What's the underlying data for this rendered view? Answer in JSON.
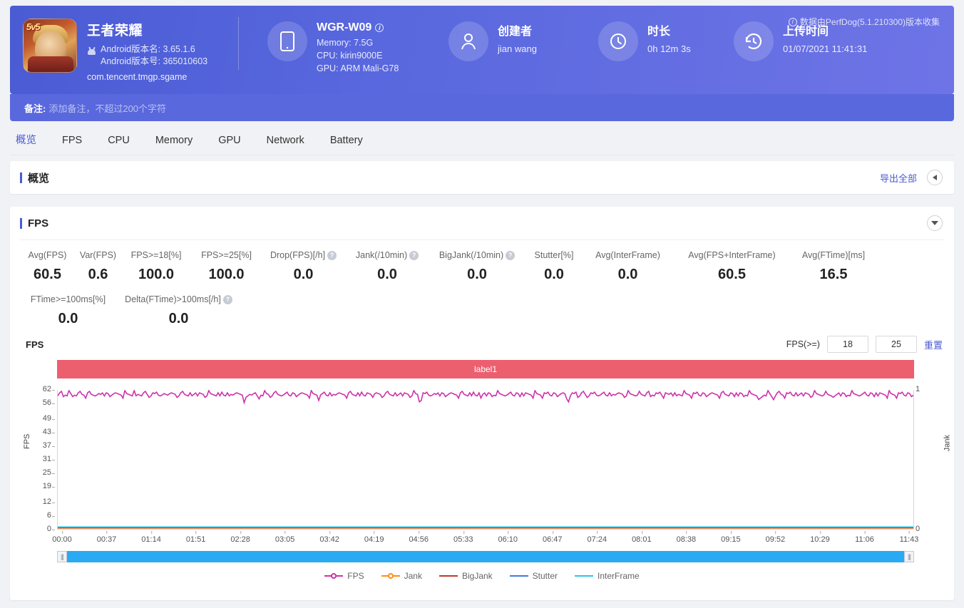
{
  "header": {
    "game": {
      "icon_badge": "5v5",
      "title": "王者荣耀",
      "android_version_name": "Android版本名: 3.65.1.6",
      "android_version_code": "Android版本号: 365010603",
      "package": "com.tencent.tmgp.sgame"
    },
    "device": {
      "icon": "phone-icon",
      "name": "WGR-W09",
      "memory": "Memory: 7.5G",
      "cpu": "CPU: kirin9000E",
      "gpu": "GPU: ARM Mali-G78"
    },
    "creator": {
      "icon": "user-icon",
      "title": "创建者",
      "value": "jian wang"
    },
    "duration": {
      "icon": "clock-icon",
      "title": "时长",
      "value": "0h 12m 3s"
    },
    "upload": {
      "icon": "history-icon",
      "title": "上传时间",
      "value": "01/07/2021 11:41:31"
    },
    "perfdog_note": "数据由PerfDog(5.1.210300)版本收集",
    "note": {
      "label": "备注:",
      "placeholder": "添加备注，不超过200个字符"
    },
    "accent": "#4a5bd4"
  },
  "tabs": [
    {
      "label": "概览",
      "active": true
    },
    {
      "label": "FPS",
      "active": false
    },
    {
      "label": "CPU",
      "active": false
    },
    {
      "label": "Memory",
      "active": false
    },
    {
      "label": "GPU",
      "active": false
    },
    {
      "label": "Network",
      "active": false
    },
    {
      "label": "Battery",
      "active": false
    }
  ],
  "overview_section": {
    "title": "概览",
    "export_all": "导出全部",
    "collapse_icon": "chevron-left-circle-icon"
  },
  "fps_section": {
    "title": "FPS",
    "collapse_icon": "chevron-down-circle-icon",
    "metrics_row1": [
      {
        "label": "Avg(FPS)",
        "value": "60.5",
        "help": false
      },
      {
        "label": "Var(FPS)",
        "value": "0.6",
        "help": false
      },
      {
        "label": "FPS>=18[%]",
        "value": "100.0",
        "help": false
      },
      {
        "label": "FPS>=25[%]",
        "value": "100.0",
        "help": false
      },
      {
        "label": "Drop(FPS)[/h]",
        "value": "0.0",
        "help": true
      },
      {
        "label": "Jank(/10min)",
        "value": "0.0",
        "help": true
      },
      {
        "label": "BigJank(/10min)",
        "value": "0.0",
        "help": true
      },
      {
        "label": "Stutter[%]",
        "value": "0.0",
        "help": false
      },
      {
        "label": "Avg(InterFrame)",
        "value": "0.0",
        "help": false
      },
      {
        "label": "Avg(FPS+InterFrame)",
        "value": "60.5",
        "help": false
      },
      {
        "label": "Avg(FTime)[ms]",
        "value": "16.5",
        "help": false
      }
    ],
    "metrics_row2": [
      {
        "label": "FTime>=100ms[%]",
        "value": "0.0",
        "help": false
      },
      {
        "label": "Delta(FTime)>100ms[/h]",
        "value": "0.0",
        "help": true
      }
    ],
    "chart_title": "FPS",
    "threshold_label": "FPS(>=)",
    "threshold_low": "18",
    "threshold_high": "25",
    "reset_label": "重置",
    "label_bar_text": "label1"
  },
  "chart_data": {
    "type": "line",
    "title": "FPS",
    "xlabel": "",
    "ylabel": "FPS",
    "y2label": "Jank",
    "ylim": [
      0,
      62
    ],
    "y2lim": [
      0,
      1
    ],
    "yticks": [
      0,
      6,
      12,
      19,
      25,
      31,
      37,
      43,
      49,
      56,
      62
    ],
    "y2ticks": [
      0,
      1
    ],
    "xticks": [
      "00:00",
      "00:37",
      "01:14",
      "01:51",
      "02:28",
      "03:05",
      "03:42",
      "04:19",
      "04:56",
      "05:33",
      "06:10",
      "06:47",
      "07:24",
      "08:01",
      "08:38",
      "09:15",
      "09:52",
      "10:29",
      "11:06",
      "11:43"
    ],
    "grid": false,
    "legend_position": "bottom",
    "series": [
      {
        "name": "FPS",
        "color": "#cc33aa",
        "axis": "left",
        "avg": 60.5,
        "values": [
          60,
          60,
          61,
          59,
          60,
          60,
          61,
          60,
          59,
          60,
          60,
          60,
          61,
          60,
          60,
          59,
          60,
          61,
          60,
          60,
          60,
          59,
          60,
          60,
          61,
          60,
          60,
          60,
          59,
          60,
          61,
          60,
          60,
          60,
          60,
          59,
          61,
          60,
          60,
          60,
          60,
          61,
          59,
          60,
          60,
          60,
          60,
          61,
          60,
          59,
          60,
          60,
          60,
          61,
          60,
          60,
          59,
          60,
          60,
          60,
          61,
          60,
          60,
          60,
          59,
          60,
          60,
          61,
          60,
          60,
          60,
          60,
          59,
          60,
          61,
          60,
          60,
          60,
          60,
          59,
          60,
          61,
          60,
          60,
          60,
          60,
          60,
          59,
          61,
          60,
          60,
          60,
          59,
          60,
          60,
          61,
          60,
          60,
          60,
          60,
          57,
          58,
          59,
          60,
          60,
          61,
          60,
          59,
          58,
          60,
          60,
          61,
          60,
          60,
          59,
          60,
          60,
          61,
          60,
          60,
          60,
          59,
          60,
          61,
          60,
          60,
          60,
          60,
          59,
          60,
          61,
          60,
          60,
          60,
          60,
          59,
          61,
          60,
          60,
          60,
          58,
          59,
          60,
          61,
          60,
          60,
          60,
          59,
          60,
          60,
          61,
          60,
          60,
          60,
          60,
          59,
          60,
          61,
          60,
          60,
          60,
          60,
          59,
          61,
          60,
          60,
          60,
          60,
          60,
          59,
          61,
          60,
          60,
          60,
          59,
          60,
          60,
          61,
          60,
          60,
          60,
          60,
          59,
          60,
          61,
          60,
          60,
          60,
          60,
          59,
          60,
          61,
          60,
          60,
          57,
          58,
          60,
          60,
          61,
          60,
          60,
          59,
          60,
          60,
          61,
          60,
          60,
          60,
          59,
          60,
          61,
          60,
          60,
          60,
          60,
          59,
          60,
          61,
          60,
          60,
          60,
          60,
          59,
          61,
          60,
          60,
          60,
          58,
          60,
          61,
          60,
          60,
          60,
          59,
          60,
          60,
          61,
          60,
          60,
          60,
          60,
          59,
          60,
          61,
          60,
          60,
          60,
          60,
          59,
          61,
          60,
          60,
          60,
          60,
          60,
          59,
          61,
          60,
          60,
          60,
          59,
          60,
          60,
          61,
          60,
          60,
          60,
          60,
          59,
          60,
          61,
          60,
          60,
          58,
          57,
          60
        ]
      },
      {
        "name": "Jank",
        "color": "#ff8c1a",
        "axis": "right",
        "values": [
          0
        ]
      },
      {
        "name": "BigJank",
        "color": "#c0392b",
        "axis": "right",
        "values": [
          0
        ]
      },
      {
        "name": "Stutter",
        "color": "#3b7ddd",
        "axis": "right",
        "values": [
          0
        ]
      },
      {
        "name": "InterFrame",
        "color": "#29c6e8",
        "axis": "left",
        "values": [
          0
        ]
      }
    ],
    "annotations": [
      {
        "type": "label-band",
        "text": "label1",
        "color": "#ec5f6e"
      }
    ]
  },
  "legend": [
    {
      "label": "FPS",
      "color": "#cc33aa",
      "marker": true
    },
    {
      "label": "Jank",
      "color": "#ff8c1a",
      "marker": true
    },
    {
      "label": "BigJank",
      "color": "#c0392b",
      "marker": false
    },
    {
      "label": "Stutter",
      "color": "#3b7ddd",
      "marker": false
    },
    {
      "label": "InterFrame",
      "color": "#29c6e8",
      "marker": false
    }
  ],
  "scrollbar": {
    "track_color": "#29aaf2",
    "handle": "⦀"
  }
}
